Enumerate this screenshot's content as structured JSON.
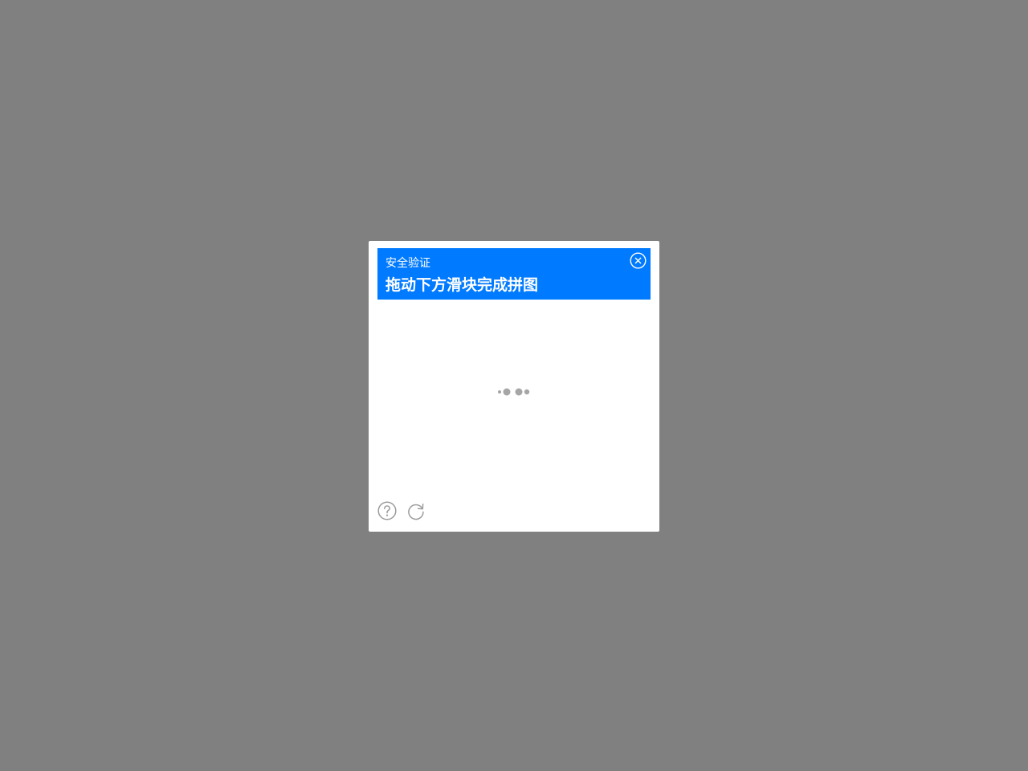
{
  "dialog": {
    "subtitle": "安全验证",
    "title": "拖动下方滑块完成拼图"
  },
  "icons": {
    "close": "close-circle-icon",
    "help": "question-circle-icon",
    "refresh": "refresh-icon",
    "loading": "loading-dots-icon"
  },
  "colors": {
    "overlay": "#808080",
    "header": "#007aff",
    "dialog_bg": "#ffffff",
    "icon_gray": "#9b9b9b",
    "loading_dots": "#a6a6a6"
  }
}
